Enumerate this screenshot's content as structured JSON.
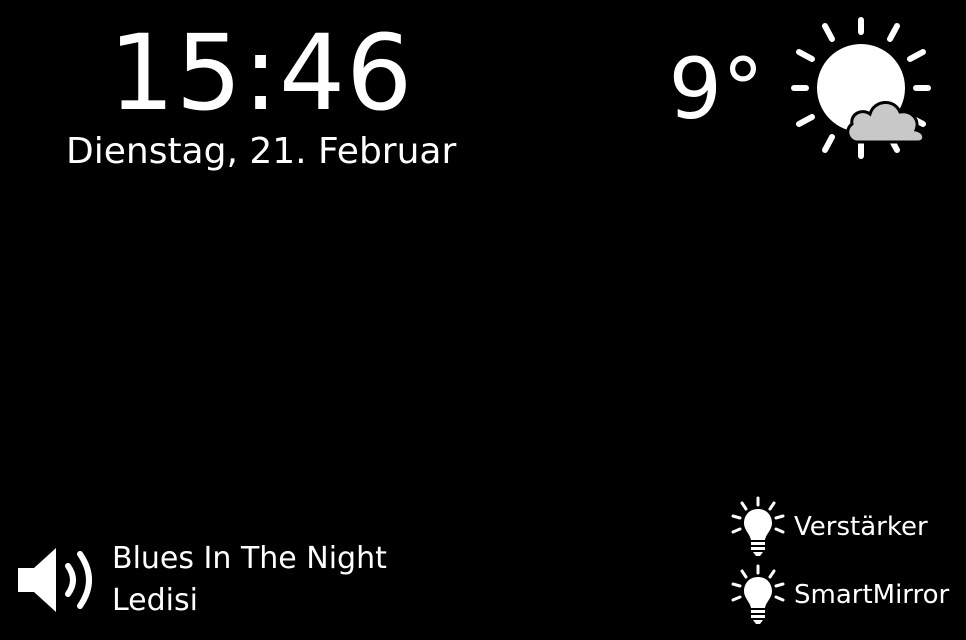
{
  "clock": {
    "time": "15:46",
    "date": "Dienstag, 21. Februar"
  },
  "weather": {
    "temperature": "9°",
    "icon": "sun-behind-cloud-icon",
    "sun_color": "#ffffff",
    "cloud_color": "#c8c8c8"
  },
  "media": {
    "icon": "speaker-volume-icon",
    "title": "Blues In The Night",
    "artist": "Ledisi"
  },
  "devices": [
    {
      "icon": "light-bulb-icon",
      "label": "Verstärker"
    },
    {
      "icon": "light-bulb-icon",
      "label": "SmartMirror"
    }
  ]
}
